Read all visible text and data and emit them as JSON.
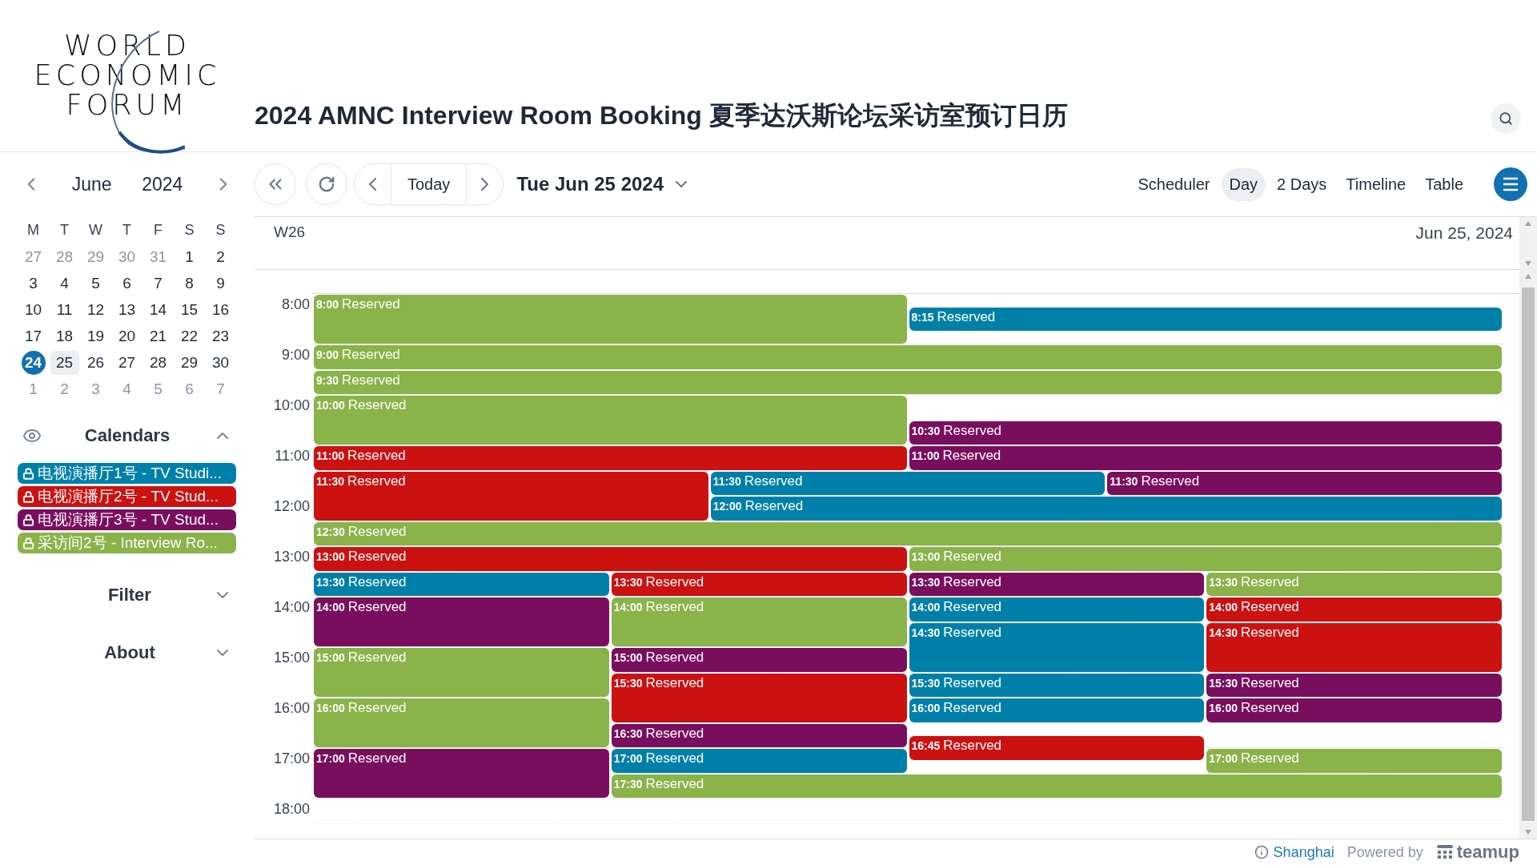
{
  "logo": {
    "lines": [
      "WORLD",
      "ECONOMIC",
      "FORUM"
    ]
  },
  "title": "2024 AMNC Interview Room Booking 夏季达沃斯论坛采访室预订日历",
  "sidebar": {
    "month": "June",
    "year": "2024",
    "weekdays": [
      "M",
      "T",
      "W",
      "T",
      "F",
      "S",
      "S"
    ],
    "weeks": [
      [
        {
          "d": "27",
          "muted": true,
          "today": false,
          "selected": false
        },
        {
          "d": "28",
          "muted": true,
          "today": false,
          "selected": false
        },
        {
          "d": "29",
          "muted": true,
          "today": false,
          "selected": false
        },
        {
          "d": "30",
          "muted": true,
          "today": false,
          "selected": false
        },
        {
          "d": "31",
          "muted": true,
          "today": false,
          "selected": false
        },
        {
          "d": "1",
          "muted": false,
          "today": false,
          "selected": false
        },
        {
          "d": "2",
          "muted": false,
          "today": false,
          "selected": false
        }
      ],
      [
        {
          "d": "3",
          "muted": false,
          "today": false,
          "selected": false
        },
        {
          "d": "4",
          "muted": false,
          "today": false,
          "selected": false
        },
        {
          "d": "5",
          "muted": false,
          "today": false,
          "selected": false
        },
        {
          "d": "6",
          "muted": false,
          "today": false,
          "selected": false
        },
        {
          "d": "7",
          "muted": false,
          "today": false,
          "selected": false
        },
        {
          "d": "8",
          "muted": false,
          "today": false,
          "selected": false
        },
        {
          "d": "9",
          "muted": false,
          "today": false,
          "selected": false
        }
      ],
      [
        {
          "d": "10",
          "muted": false,
          "today": false,
          "selected": false
        },
        {
          "d": "11",
          "muted": false,
          "today": false,
          "selected": false
        },
        {
          "d": "12",
          "muted": false,
          "today": false,
          "selected": false
        },
        {
          "d": "13",
          "muted": false,
          "today": false,
          "selected": false
        },
        {
          "d": "14",
          "muted": false,
          "today": false,
          "selected": false
        },
        {
          "d": "15",
          "muted": false,
          "today": false,
          "selected": false
        },
        {
          "d": "16",
          "muted": false,
          "today": false,
          "selected": false
        }
      ],
      [
        {
          "d": "17",
          "muted": false,
          "today": false,
          "selected": false
        },
        {
          "d": "18",
          "muted": false,
          "today": false,
          "selected": false
        },
        {
          "d": "19",
          "muted": false,
          "today": false,
          "selected": false
        },
        {
          "d": "20",
          "muted": false,
          "today": false,
          "selected": false
        },
        {
          "d": "21",
          "muted": false,
          "today": false,
          "selected": false
        },
        {
          "d": "22",
          "muted": false,
          "today": false,
          "selected": false
        },
        {
          "d": "23",
          "muted": false,
          "today": false,
          "selected": false
        }
      ],
      [
        {
          "d": "24",
          "muted": false,
          "today": true,
          "selected": false
        },
        {
          "d": "25",
          "muted": false,
          "today": false,
          "selected": true
        },
        {
          "d": "26",
          "muted": false,
          "today": false,
          "selected": false
        },
        {
          "d": "27",
          "muted": false,
          "today": false,
          "selected": false
        },
        {
          "d": "28",
          "muted": false,
          "today": false,
          "selected": false
        },
        {
          "d": "29",
          "muted": false,
          "today": false,
          "selected": false
        },
        {
          "d": "30",
          "muted": false,
          "today": false,
          "selected": false
        }
      ],
      [
        {
          "d": "1",
          "muted": true,
          "today": false,
          "selected": false
        },
        {
          "d": "2",
          "muted": true,
          "today": false,
          "selected": false
        },
        {
          "d": "3",
          "muted": true,
          "today": false,
          "selected": false
        },
        {
          "d": "4",
          "muted": true,
          "today": false,
          "selected": false
        },
        {
          "d": "5",
          "muted": true,
          "today": false,
          "selected": false
        },
        {
          "d": "6",
          "muted": true,
          "today": false,
          "selected": false
        },
        {
          "d": "7",
          "muted": true,
          "today": false,
          "selected": false
        }
      ]
    ],
    "sections": [
      {
        "kind": "calendars",
        "label": "Calendars",
        "expanded": true,
        "items": [
          {
            "label": "电视演播厅1号 - TV Studi...",
            "color": "#0080a8"
          },
          {
            "label": "电视演播厅2号 - TV Stud...",
            "color": "#cc1111"
          },
          {
            "label": "电视演播厅3号 - TV Stud...",
            "color": "#7a0e5e"
          },
          {
            "label": "采访间2号 - Interview Ro...",
            "color": "#8ab34a"
          }
        ]
      },
      {
        "kind": "plain",
        "label": "Filter",
        "expanded": false
      },
      {
        "kind": "plain",
        "label": "About",
        "expanded": false
      }
    ]
  },
  "toolbar": {
    "today": "Today",
    "date": "Tue Jun 25 2024",
    "views": [
      {
        "label": "Scheduler",
        "selected": false
      },
      {
        "label": "Day",
        "selected": true
      },
      {
        "label": "2 Days",
        "selected": false
      },
      {
        "label": "Timeline",
        "selected": false
      },
      {
        "label": "Table",
        "selected": false
      }
    ]
  },
  "day_header": {
    "week": "W26",
    "date": "Jun 25, 2024"
  },
  "hours": [
    "8:00",
    "9:00",
    "10:00",
    "11:00",
    "12:00",
    "13:00",
    "14:00",
    "15:00",
    "16:00",
    "17:00",
    "18:00"
  ],
  "events": [
    {
      "kind": "hour",
      "time": "8:00",
      "title": "Reserved",
      "color": "#8ab34a"
    },
    {
      "kind": "half-hour",
      "time": "8:15",
      "title": "Reserved",
      "color": "#0080a8"
    },
    {
      "kind": "half-hour",
      "time": "9:00",
      "title": "Reserved",
      "color": "#8ab34a"
    },
    {
      "kind": "half-hour",
      "time": "9:30",
      "title": "Reserved",
      "color": "#8ab34a"
    },
    {
      "kind": "hour",
      "time": "10:00",
      "title": "Reserved",
      "color": "#8ab34a"
    },
    {
      "kind": "half-hour",
      "time": "10:30",
      "title": "Reserved",
      "color": "#7a0e5e"
    },
    {
      "kind": "half-hour",
      "time": "11:00",
      "title": "Reserved",
      "color": "#cc1111"
    },
    {
      "kind": "half-hour",
      "time": "11:00",
      "title": "Reserved",
      "color": "#7a0e5e"
    },
    {
      "kind": "hour",
      "time": "11:30",
      "title": "Reserved",
      "color": "#cc1111"
    },
    {
      "kind": "half-hour",
      "time": "11:30",
      "title": "Reserved",
      "color": "#0080a8"
    },
    {
      "kind": "half-hour",
      "time": "11:30",
      "title": "Reserved",
      "color": "#7a0e5e"
    },
    {
      "kind": "half-hour",
      "time": "12:00",
      "title": "Reserved",
      "color": "#0080a8"
    },
    {
      "kind": "half-hour",
      "time": "12:30",
      "title": "Reserved",
      "color": "#8ab34a"
    },
    {
      "kind": "half-hour",
      "time": "13:00",
      "title": "Reserved",
      "color": "#cc1111"
    },
    {
      "kind": "half-hour",
      "time": "13:00",
      "title": "Reserved",
      "color": "#8ab34a"
    },
    {
      "kind": "half-hour",
      "time": "13:30",
      "title": "Reserved",
      "color": "#0080a8"
    },
    {
      "kind": "half-hour",
      "time": "13:30",
      "title": "Reserved",
      "color": "#cc1111"
    },
    {
      "kind": "half-hour",
      "time": "13:30",
      "title": "Reserved",
      "color": "#7a0e5e"
    },
    {
      "kind": "half-hour",
      "time": "13:30",
      "title": "Reserved",
      "color": "#8ab34a"
    },
    {
      "kind": "hour",
      "time": "14:00",
      "title": "Reserved",
      "color": "#7a0e5e"
    },
    {
      "kind": "hour",
      "time": "14:00",
      "title": "Reserved",
      "color": "#8ab34a"
    },
    {
      "kind": "half-hour",
      "time": "14:00",
      "title": "Reserved",
      "color": "#0080a8"
    },
    {
      "kind": "half-hour",
      "time": "14:00",
      "title": "Reserved",
      "color": "#cc1111"
    },
    {
      "kind": "hour",
      "time": "14:30",
      "title": "Reserved",
      "color": "#0080a8"
    },
    {
      "kind": "hour",
      "time": "14:30",
      "title": "Reserved",
      "color": "#cc1111"
    },
    {
      "kind": "hour",
      "time": "15:00",
      "title": "Reserved",
      "color": "#8ab34a"
    },
    {
      "kind": "half-hour",
      "time": "15:00",
      "title": "Reserved",
      "color": "#7a0e5e"
    },
    {
      "kind": "hour",
      "time": "15:30",
      "title": "Reserved",
      "color": "#cc1111"
    },
    {
      "kind": "half-hour",
      "time": "15:30",
      "title": "Reserved",
      "color": "#0080a8"
    },
    {
      "kind": "half-hour",
      "time": "15:30",
      "title": "Reserved",
      "color": "#7a0e5e"
    },
    {
      "kind": "hour",
      "time": "16:00",
      "title": "Reserved",
      "color": "#8ab34a"
    },
    {
      "kind": "half-hour",
      "time": "16:00",
      "title": "Reserved",
      "color": "#0080a8"
    },
    {
      "kind": "half-hour",
      "time": "16:00",
      "title": "Reserved",
      "color": "#7a0e5e"
    },
    {
      "kind": "half-hour",
      "time": "16:30",
      "title": "Reserved",
      "color": "#7a0e5e"
    },
    {
      "kind": "half-hour",
      "time": "16:45",
      "title": "Reserved",
      "color": "#cc1111"
    },
    {
      "kind": "hour",
      "time": "17:00",
      "title": "Reserved",
      "color": "#7a0e5e"
    },
    {
      "kind": "half-hour",
      "time": "17:00",
      "title": "Reserved",
      "color": "#0080a8"
    },
    {
      "kind": "half-hour",
      "time": "17:00",
      "title": "Reserved",
      "color": "#8ab34a"
    },
    {
      "kind": "half-hour",
      "time": "17:30",
      "title": "Reserved",
      "color": "#8ab34a"
    }
  ],
  "footer": {
    "timezone": "Shanghai",
    "powered": "Powered by",
    "brand": "teamup"
  }
}
